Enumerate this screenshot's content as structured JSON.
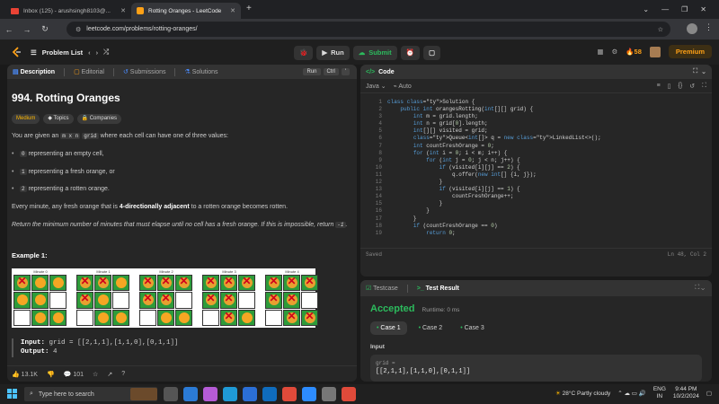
{
  "browser": {
    "tabs": [
      {
        "label": "Inbox (125) - arushsingh8103@..."
      },
      {
        "label": "Rotting Oranges - LeetCode"
      }
    ],
    "url": "leetcode.com/problems/rotting-oranges/"
  },
  "lcbar": {
    "problem_list": "Problem List",
    "run": "Run",
    "submit": "Submit",
    "streak": "58",
    "premium": "Premium"
  },
  "left": {
    "tabs": [
      "Description",
      "Editorial",
      "Submissions",
      "Solutions"
    ],
    "run_label": "Run",
    "ctrl_label": "Ctrl",
    "title": "994. Rotting Oranges",
    "difficulty": "Medium",
    "topics": "Topics",
    "companies": "Companies",
    "p1a": "You are given an",
    "p1code": "m x n",
    "p1code2": "grid",
    "p1b": "where each cell can have one of three values:",
    "bullets": [
      {
        "code": "0",
        "text": "representing an empty cell,"
      },
      {
        "code": "1",
        "text": "representing a fresh orange, or"
      },
      {
        "code": "2",
        "text": "representing a rotten orange."
      }
    ],
    "p2a": "Every minute, any fresh orange that is",
    "p2bold": "4-directionally adjacent",
    "p2b": "to a rotten orange becomes rotten.",
    "p3a": "Return the minimum number of minutes that must elapse until no cell has a fresh orange. If this is impossible, return",
    "p3code": "-1",
    "p3b": ".",
    "example_title": "Example 1:",
    "minutes": [
      "Minute 0",
      "Minute 1",
      "Minute 2",
      "Minute 3",
      "Minute 4"
    ],
    "input_label": "Input:",
    "input_val": "grid = [[2,1,1],[1,1,0],[0,1,1]]",
    "output_label": "Output:",
    "output_val": "4",
    "likes": "13.1K",
    "comments": "101"
  },
  "code": {
    "header": "Code",
    "lang": "Java",
    "auto": "Auto",
    "lines": [
      "class Solution {",
      "    public int orangesRotting(int[][] grid) {",
      "        int m = grid.length;",
      "        int n = grid[0].length;",
      "        int[][] visited = grid;",
      "        Queue<int[]> q = new LinkedList<>();",
      "        int countFreshOrange = 0;",
      "        for (int i = 0; i < m; i++) {",
      "            for (int j = 0; j < n; j++) {",
      "                if (visited[i][j] == 2) {",
      "                    q.offer(new int[] {i, j});",
      "                }",
      "                if (visited[i][j] == 1) {",
      "                    countFreshOrange++;",
      "                }",
      "            }",
      "        }",
      "        if (countFreshOrange == 0)",
      "            return 0;"
    ],
    "saved": "Saved",
    "pos": "Ln 48, Col 2"
  },
  "test": {
    "tab1": "Testcase",
    "tab2": "Test Result",
    "status": "Accepted",
    "runtime": "Runtime: 0 ms",
    "cases": [
      "Case 1",
      "Case 2",
      "Case 3"
    ],
    "input": "Input",
    "var": "grid =",
    "val": "[[2,1,1],[1,1,0],[0,1,1]]"
  },
  "taskbar": {
    "search": "Type here to search",
    "weather": "28°C  Partly cloudy",
    "lang1": "ENG",
    "lang2": "IN",
    "time": "9:44 PM",
    "date": "10/2/2024"
  },
  "grid": {
    "minute0": [
      [
        2,
        1,
        1
      ],
      [
        1,
        1,
        0
      ],
      [
        0,
        1,
        1
      ]
    ],
    "minute1": [
      [
        2,
        2,
        1
      ],
      [
        2,
        1,
        0
      ],
      [
        0,
        1,
        1
      ]
    ],
    "minute2": [
      [
        2,
        2,
        2
      ],
      [
        2,
        2,
        0
      ],
      [
        0,
        1,
        1
      ]
    ],
    "minute3": [
      [
        2,
        2,
        2
      ],
      [
        2,
        2,
        0
      ],
      [
        0,
        2,
        1
      ]
    ],
    "minute4": [
      [
        2,
        2,
        2
      ],
      [
        2,
        2,
        0
      ],
      [
        0,
        2,
        2
      ]
    ]
  }
}
